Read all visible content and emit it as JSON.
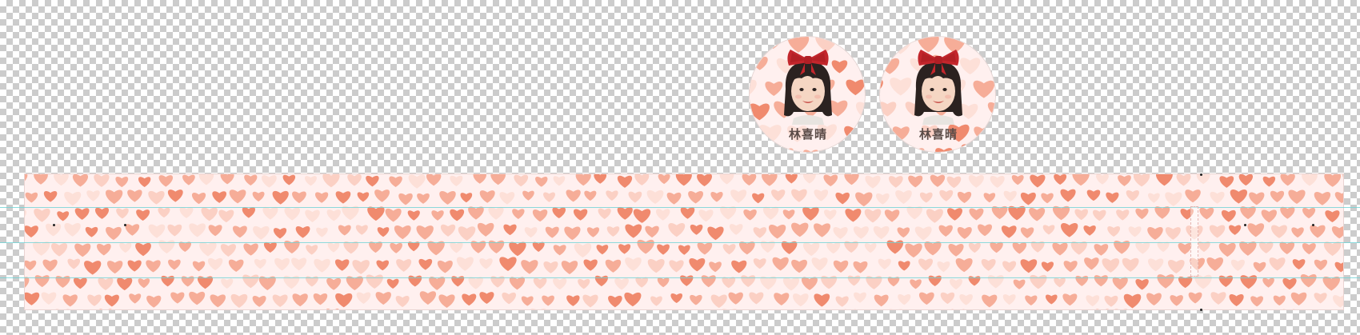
{
  "canvas": {
    "background": "transparent-checkerboard"
  },
  "stickers": [
    {
      "name_text": "林喜晴",
      "icon": "child-portrait-with-red-bow"
    },
    {
      "name_text": "林喜晴",
      "icon": "child-portrait-with-red-bow"
    }
  ],
  "ribbon": {
    "pattern": "hearts",
    "colors": {
      "background": "#fff0ef",
      "heart_dark": "#f08a6e",
      "heart_mid": "#f6ad98",
      "heart_light": "#fbd0c4",
      "heart_pale": "#fde0d8"
    }
  },
  "guides": {
    "color": "#6fd3d6",
    "count": 3
  }
}
